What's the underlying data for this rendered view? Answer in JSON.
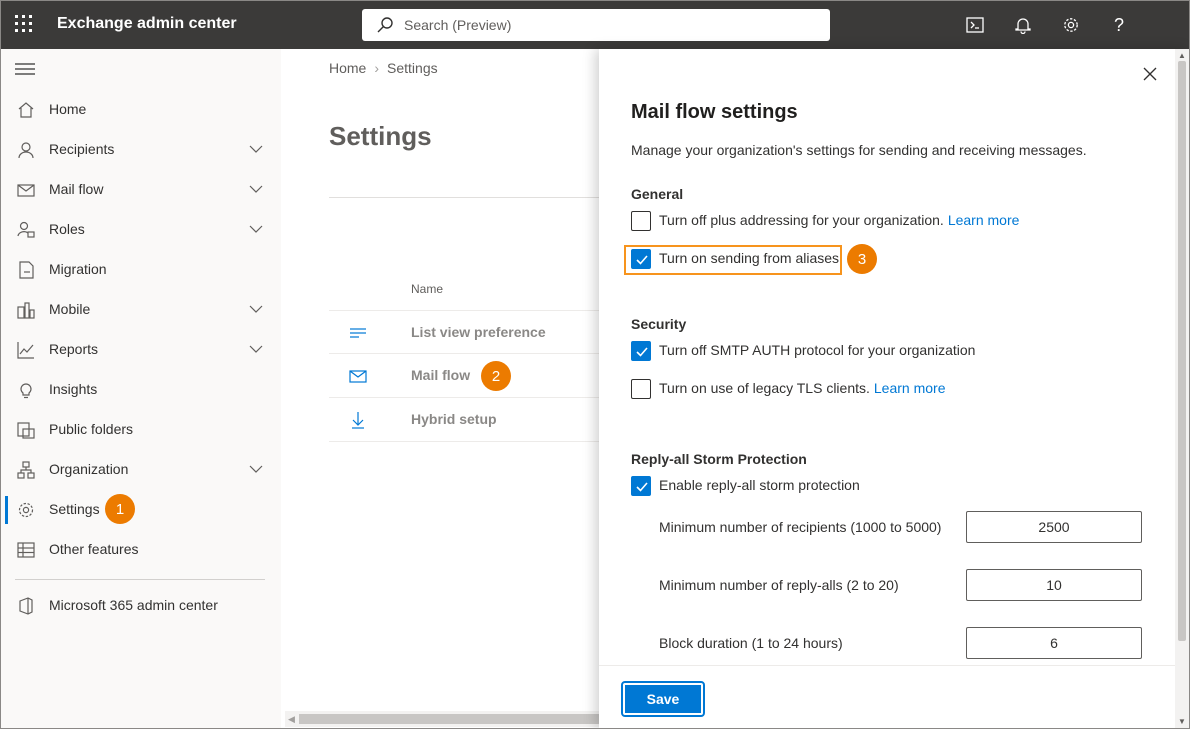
{
  "app": {
    "title": "Exchange admin center"
  },
  "search": {
    "placeholder": "Search (Preview)"
  },
  "topbar": {
    "icons": [
      "cloud-shell-icon",
      "bell-icon",
      "gear-icon",
      "help-icon"
    ]
  },
  "nav": {
    "items": [
      {
        "label": "Home",
        "icon": "home-icon",
        "expandable": false
      },
      {
        "label": "Recipients",
        "icon": "person-icon",
        "expandable": true
      },
      {
        "label": "Mail flow",
        "icon": "mail-icon",
        "expandable": true
      },
      {
        "label": "Roles",
        "icon": "roles-icon",
        "expandable": true
      },
      {
        "label": "Migration",
        "icon": "migration-icon",
        "expandable": false
      },
      {
        "label": "Mobile",
        "icon": "mobile-icon",
        "expandable": true
      },
      {
        "label": "Reports",
        "icon": "chart-icon",
        "expandable": true
      },
      {
        "label": "Insights",
        "icon": "lightbulb-icon",
        "expandable": false
      },
      {
        "label": "Public folders",
        "icon": "folder-icon",
        "expandable": false
      },
      {
        "label": "Organization",
        "icon": "org-icon",
        "expandable": true
      },
      {
        "label": "Settings",
        "icon": "gear-icon",
        "expandable": false,
        "active": true
      },
      {
        "label": "Other features",
        "icon": "grid-icon",
        "expandable": false
      }
    ],
    "footer_item": {
      "label": "Microsoft 365 admin center",
      "icon": "office-icon"
    }
  },
  "callouts": {
    "one": "1",
    "two": "2",
    "three": "3"
  },
  "breadcrumb": {
    "home": "Home",
    "current": "Settings"
  },
  "page": {
    "title": "Settings",
    "column_name": "Name"
  },
  "settings_list": [
    {
      "label": "List view preference",
      "icon": "list-icon"
    },
    {
      "label": "Mail flow",
      "icon": "mail-icon"
    },
    {
      "label": "Hybrid setup",
      "icon": "download-icon"
    }
  ],
  "panel": {
    "title": "Mail flow settings",
    "description": "Manage your organization's settings for sending and receiving messages.",
    "general": {
      "heading": "General",
      "plus_addressing": {
        "label": "Turn off plus addressing for your organization.",
        "link": "Learn more",
        "checked": false
      },
      "send_from_aliases": {
        "label": "Turn on sending from aliases",
        "checked": true
      }
    },
    "security": {
      "heading": "Security",
      "smtp_auth": {
        "label": "Turn off SMTP AUTH protocol for your organization",
        "checked": true
      },
      "legacy_tls": {
        "label": "Turn on use of legacy TLS clients.",
        "link": "Learn more",
        "checked": false
      }
    },
    "storm": {
      "heading": "Reply-all Storm Protection",
      "enable": {
        "label": "Enable reply-all storm protection",
        "checked": true
      },
      "min_recipients": {
        "label": "Minimum number of recipients (1000 to 5000)",
        "value": "2500"
      },
      "min_reply_alls": {
        "label": "Minimum number of reply-alls (2 to 20)",
        "value": "10"
      },
      "block_duration": {
        "label": "Block duration (1 to 24 hours)",
        "value": "6"
      }
    },
    "save_label": "Save"
  },
  "colors": {
    "accent": "#0078d4",
    "callout": "#ec7b00",
    "highlight": "#f7941d",
    "topbar": "#3b3a39"
  }
}
